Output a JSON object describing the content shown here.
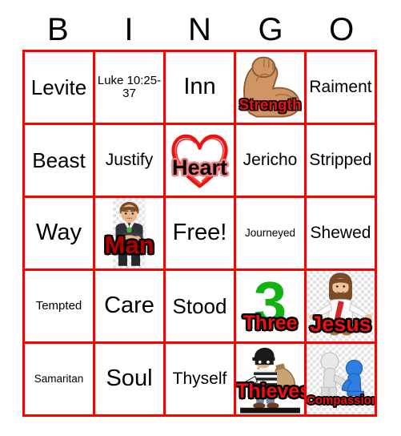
{
  "card": {
    "title_letters": [
      "B",
      "I",
      "N",
      "G",
      "O"
    ],
    "grid_line_color": "#ff0000",
    "background_color": "#ffffff",
    "rows": 5,
    "columns": 5
  },
  "cells": [
    {
      "id": "b1",
      "label": "Levite",
      "kind": "text",
      "size": "lg"
    },
    {
      "id": "i1",
      "label": "Luke 10:25-37",
      "kind": "text",
      "size": "sm"
    },
    {
      "id": "n1",
      "label": "Inn",
      "kind": "text",
      "size": "xl"
    },
    {
      "id": "g1",
      "label": "Strength",
      "kind": "image",
      "art": "flexed-biceps-icon",
      "text_color": "#ee1111",
      "outline_color": "#000000"
    },
    {
      "id": "o1",
      "label": "Raiment",
      "kind": "text",
      "size": "md"
    },
    {
      "id": "b2",
      "label": "Beast",
      "kind": "text",
      "size": "lg"
    },
    {
      "id": "i2",
      "label": "Justify",
      "kind": "text",
      "size": "md"
    },
    {
      "id": "n2",
      "label": "Heart",
      "kind": "image",
      "art": "heart-outline-icon",
      "text_color": "#000000",
      "outline_color": "#f08080"
    },
    {
      "id": "g2",
      "label": "Jericho",
      "kind": "text",
      "size": "md"
    },
    {
      "id": "o2",
      "label": "Stripped",
      "kind": "text",
      "size": "md"
    },
    {
      "id": "b3",
      "label": "Way",
      "kind": "text",
      "size": "xl"
    },
    {
      "id": "i3",
      "label": "Man",
      "kind": "image",
      "art": "businessman-icon",
      "text_color": "#b20000",
      "outline_color": "#000000"
    },
    {
      "id": "n3",
      "label": "Free!",
      "kind": "text",
      "size": "xl"
    },
    {
      "id": "g3",
      "label": "Journeyed",
      "kind": "text",
      "size": "xs"
    },
    {
      "id": "o3",
      "label": "Shewed",
      "kind": "text",
      "size": "md"
    },
    {
      "id": "b4",
      "label": "Tempted",
      "kind": "text",
      "size": "sm"
    },
    {
      "id": "i4",
      "label": "Care",
      "kind": "text",
      "size": "xl"
    },
    {
      "id": "n4",
      "label": "Stood",
      "kind": "text",
      "size": "lg"
    },
    {
      "id": "g4",
      "label": "Three",
      "kind": "image",
      "art": "number-three-icon",
      "numeral": "3",
      "numeral_color": "#11b211",
      "text_color": "#ee1111",
      "outline_color": "#000000"
    },
    {
      "id": "o4",
      "label": "Jesus",
      "kind": "image",
      "art": "jesus-icon",
      "text_color": "#ee1111",
      "outline_color": "#000000"
    },
    {
      "id": "b5",
      "label": "Samaritan",
      "kind": "text",
      "size": "xs"
    },
    {
      "id": "i5",
      "label": "Soul",
      "kind": "text",
      "size": "xl"
    },
    {
      "id": "n5",
      "label": "Thyself",
      "kind": "text",
      "size": "md"
    },
    {
      "id": "g5",
      "label": "Thieves",
      "kind": "image",
      "art": "burglar-icon",
      "text_color": "#ee1111",
      "outline_color": "#000000"
    },
    {
      "id": "o5",
      "label": "Compassion",
      "kind": "image",
      "art": "helping-figures-icon",
      "text_color": "#ee1111",
      "outline_color": "#000000"
    }
  ]
}
